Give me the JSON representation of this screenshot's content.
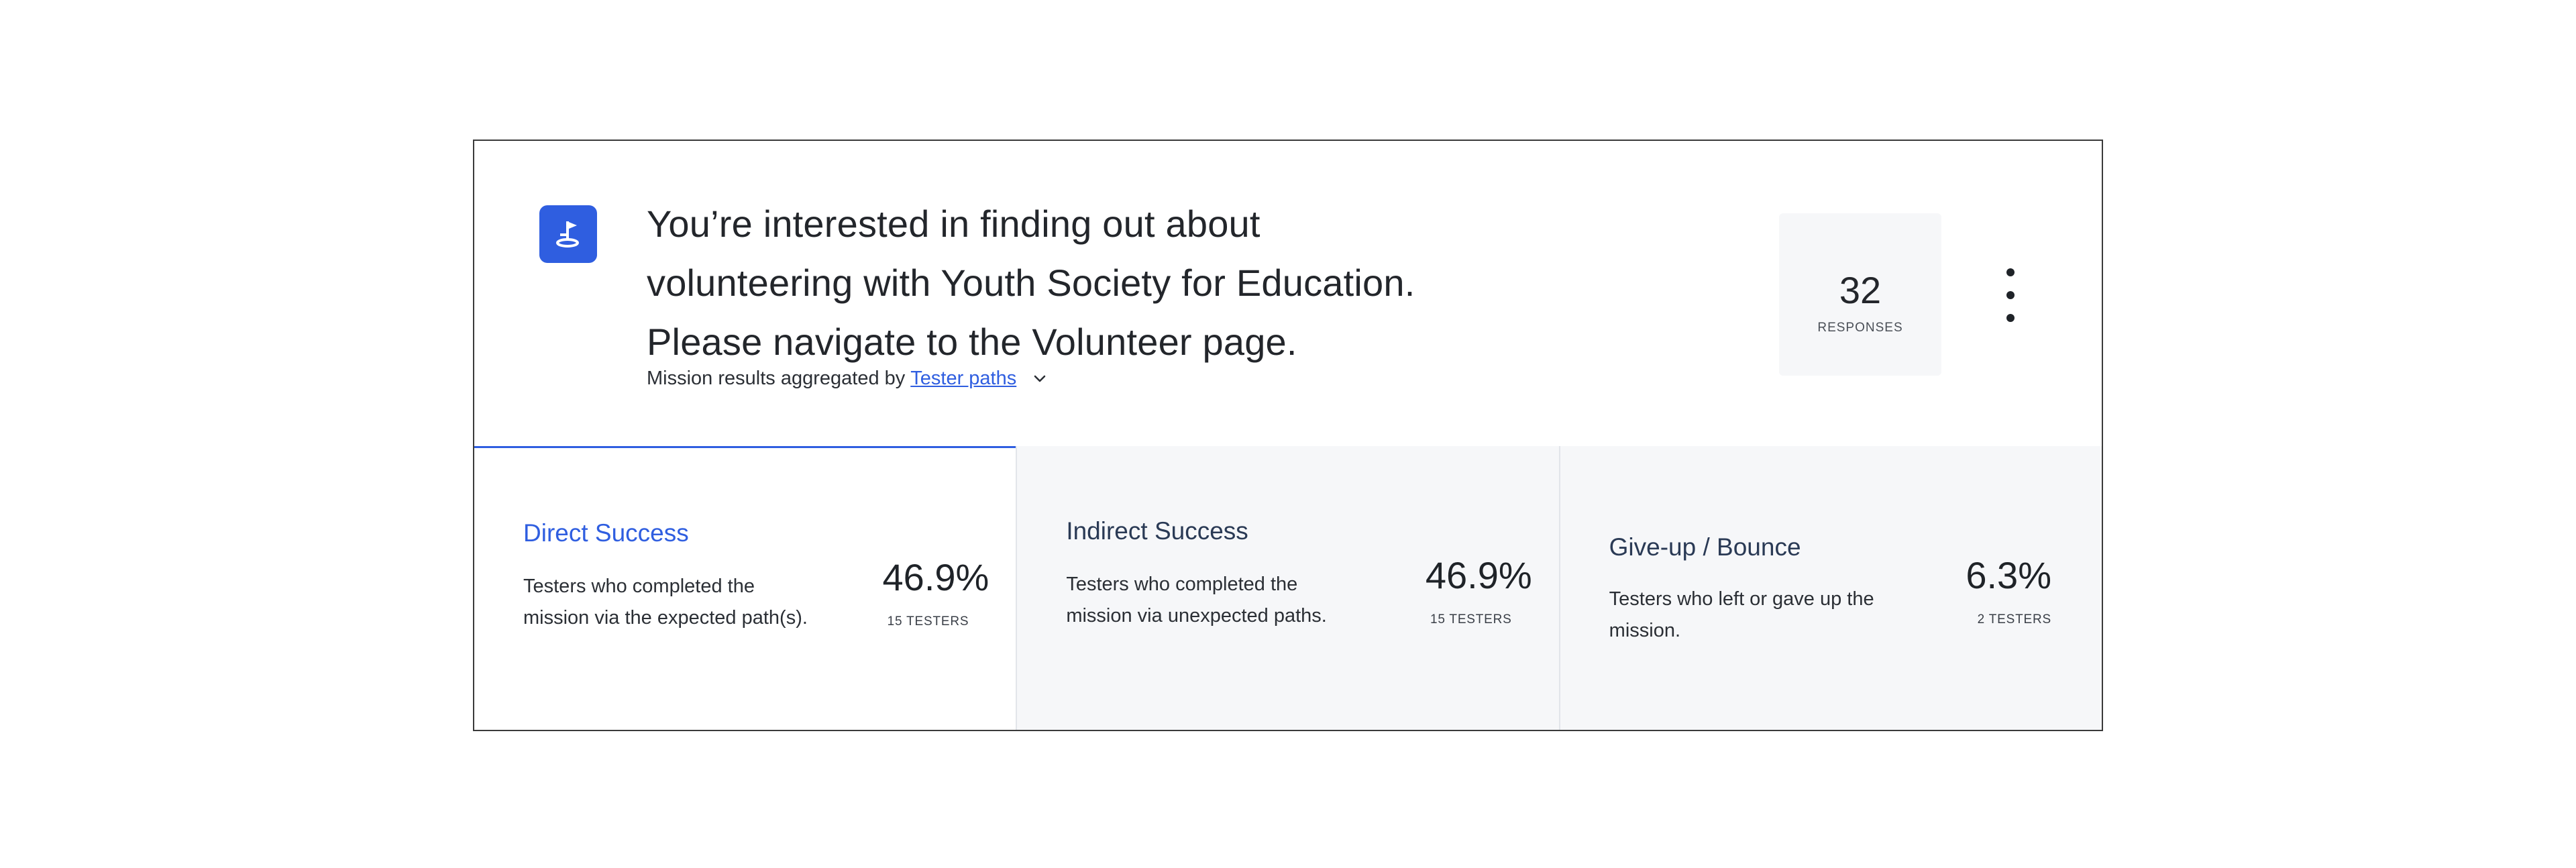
{
  "mission": {
    "lines": [
      "You’re interested in finding out about",
      "volunteering with Youth Society for Education.",
      "Please navigate to the Volunteer page."
    ],
    "aggregated_prefix": "Mission results aggregated by",
    "aggregated_link": "Tester paths",
    "icon": "flag-on-pin-icon",
    "accent_color": "#2f5ee0"
  },
  "responses": {
    "count": "32",
    "label": "RESPONSES"
  },
  "menu_icon": "more-vertical-icon",
  "stats": [
    {
      "title": "Direct Success",
      "description": "Testers who completed the mission via the expected path(s).",
      "percent": "46.9%",
      "testers": "15 TESTERS"
    },
    {
      "title": "Indirect Success",
      "description": "Testers who completed the mission via unexpected paths.",
      "percent": "46.9%",
      "testers": "15 TESTERS"
    },
    {
      "title": "Give-up / Bounce",
      "description": "Testers who left or gave up the mission.",
      "percent": "6.3%",
      "testers": "2 TESTERS"
    }
  ]
}
